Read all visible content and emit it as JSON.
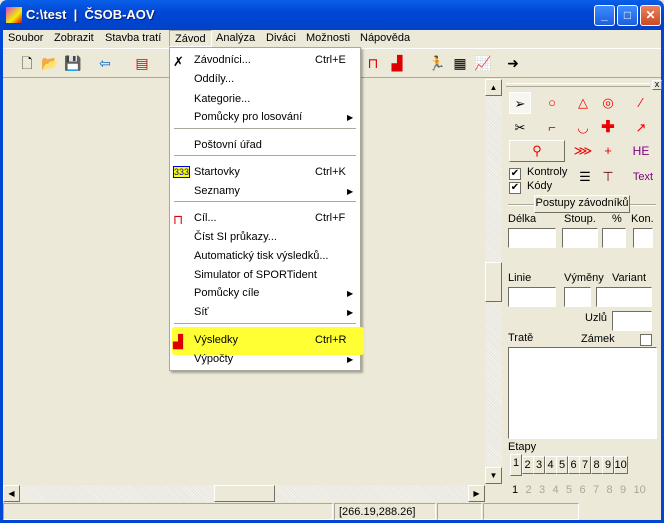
{
  "window": {
    "title": "C:\\test  |  ČSOB-AOV",
    "minimize": "_",
    "maximize": "□",
    "close": "✕"
  },
  "menubar": [
    "Soubor",
    "Zobrazit",
    "Stavba tratí",
    "Závod",
    "Analýza",
    "Diváci",
    "Možnosti",
    "Nápověda"
  ],
  "dropdown": {
    "items": [
      {
        "label": "Závodníci...",
        "shortcut": "Ctrl+E",
        "icon": "runner-icon"
      },
      {
        "label": "Oddíly..."
      },
      {
        "label": "Kategorie..."
      },
      {
        "label": "Pomůcky pro losování",
        "submenu": true
      },
      {
        "label": "Poštovní úřad"
      },
      {
        "label": "Startovky",
        "shortcut": "Ctrl+K",
        "icon": "start-list-icon"
      },
      {
        "label": "Seznamy",
        "submenu": true
      },
      {
        "label": "Cíl...",
        "shortcut": "Ctrl+F",
        "icon": "finish-icon"
      },
      {
        "label": "Číst SI průkazy..."
      },
      {
        "label": "Automatický tisk výsledků..."
      },
      {
        "label": "Simulator of SPORTident"
      },
      {
        "label": "Pomůcky cíle",
        "submenu": true
      },
      {
        "label": "Síť",
        "submenu": true
      },
      {
        "label": "Výsledky",
        "shortcut": "Ctrl+R",
        "icon": "podium-icon",
        "highlighted": true
      },
      {
        "label": "Výpočty",
        "submenu": true
      }
    ],
    "highlight_color": "#ffff33",
    "start_icon_text": "333"
  },
  "panel": {
    "close": "x",
    "kontroly": "Kontroly",
    "kody": "Kódy",
    "kontroly_checked": true,
    "kody_checked": true,
    "he": "HE",
    "text": "Text",
    "postupy": "Postupy závodníků",
    "delka": "Délka",
    "stoup": "Stoup.",
    "pct": "%",
    "kon": "Kon.",
    "linie": "Linie",
    "vymeny": "Výměny",
    "variant": "Variant",
    "uzlu": "Uzlů",
    "trate": "Tratě",
    "zamek": "Zámek",
    "etapy": "Etapy",
    "etapy_tabs": [
      "1",
      "2",
      "3",
      "4",
      "5",
      "6",
      "7",
      "8",
      "9",
      "10"
    ],
    "etapy_nums": [
      "1",
      "2",
      "3",
      "4",
      "5",
      "6",
      "7",
      "8",
      "9",
      "10"
    ]
  },
  "status": {
    "coords": "[266.19,288.26]"
  }
}
